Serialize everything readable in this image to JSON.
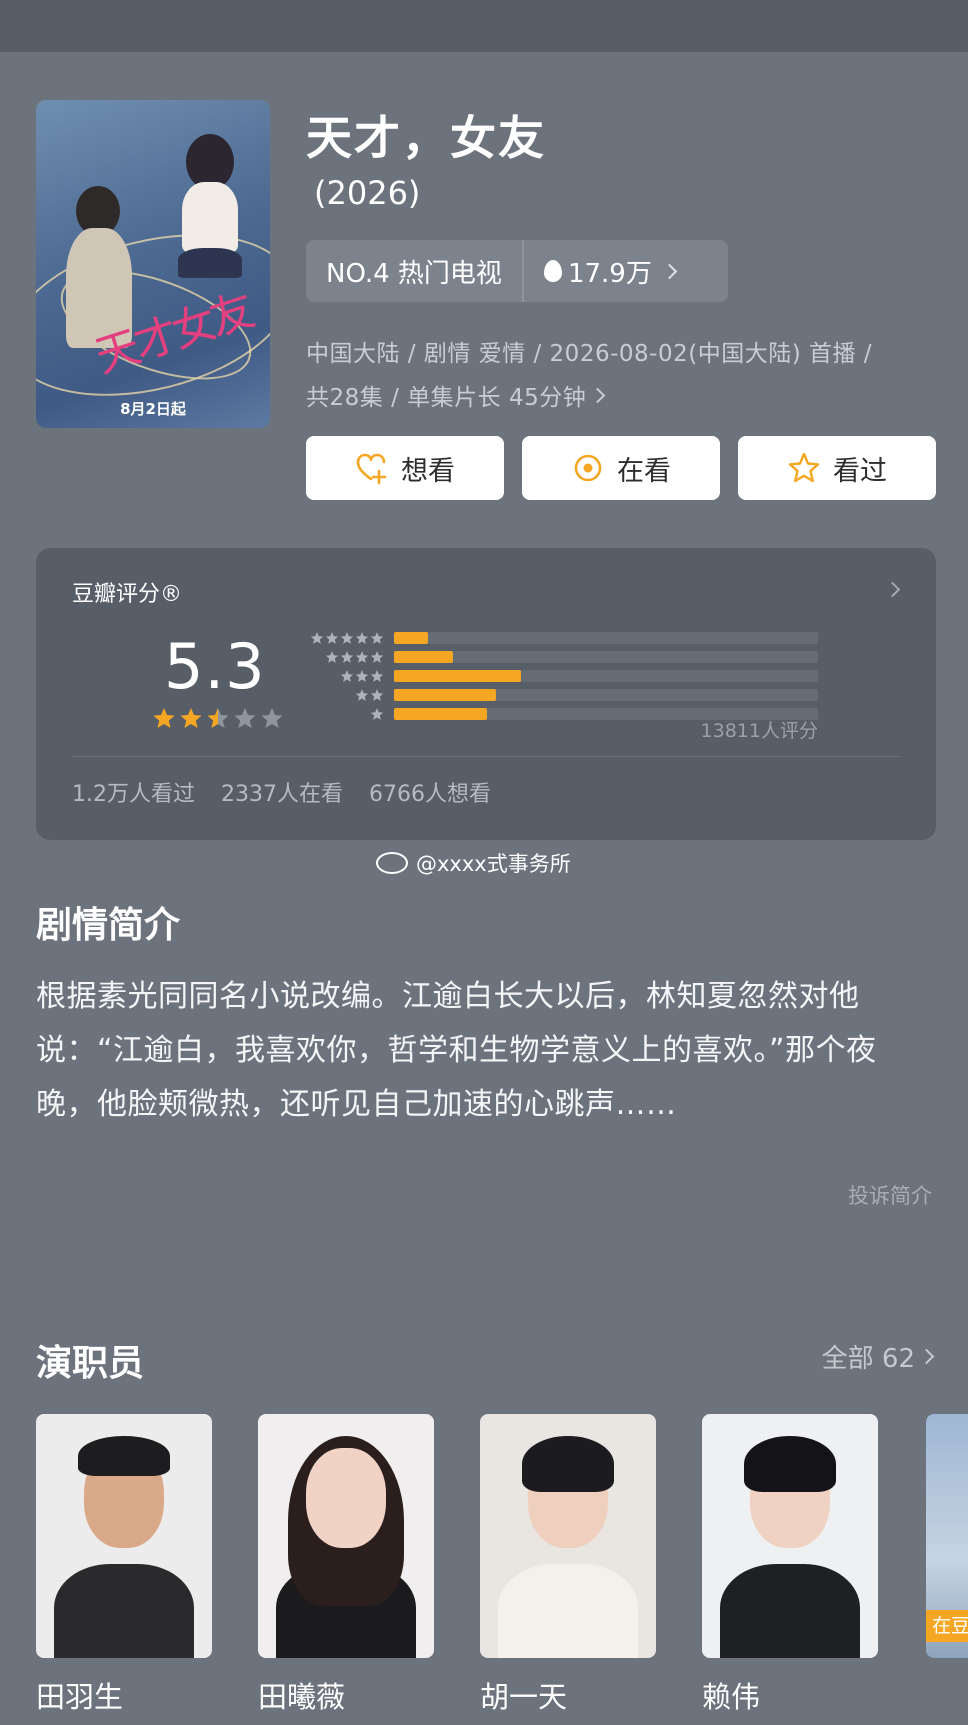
{
  "show": {
    "title": "天才，女友",
    "year": "(2026)",
    "poster_title": "天才女友",
    "poster_date": "8月2日起",
    "rank_label": "NO.4 热门电视",
    "heat": "17.9万",
    "meta_line1": "中国大陆 / 剧情 爱情 / 2026-08-02(中国大陆) 首播 /",
    "meta_line2": "共28集 / 单集片长 45分钟"
  },
  "actions": [
    {
      "label": "想看",
      "icon": "heart-plus-icon"
    },
    {
      "label": "在看",
      "icon": "target-circle-icon"
    },
    {
      "label": "看过",
      "icon": "star-outline-icon"
    }
  ],
  "rating": {
    "label": "豆瓣评分®",
    "score": "5.3",
    "stars": 2.5,
    "distribution_pct": [
      8,
      14,
      30,
      24,
      22
    ],
    "count": "13811人评分",
    "watched": "1.2万人看过",
    "watching": "2337人在看",
    "want": "6766人想看",
    "accent": "#f5a623"
  },
  "watermark": "@xxxx式事务所",
  "synopsis": {
    "title": "剧情简介",
    "text": "根据素光同同名小说改编。江逾白长大以后，林知夏忽然对他说：“江逾白，我喜欢你，哲学和生物学意义上的喜欢。”那个夜晚，他脸颊微热，还听见自己加速的心跳声……",
    "report": "投诉简介"
  },
  "cast": {
    "title": "演职员",
    "all_label": "全部 62",
    "members": [
      {
        "name": "田羽生"
      },
      {
        "name": "田曦薇"
      },
      {
        "name": "胡一天"
      },
      {
        "name": "赖伟"
      }
    ],
    "partial_badge": "在豆"
  }
}
